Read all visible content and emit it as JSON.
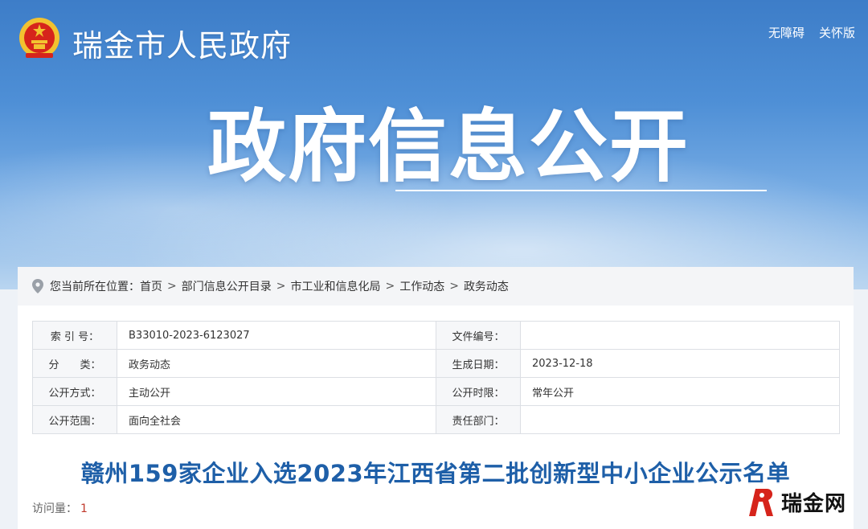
{
  "header": {
    "site_title": "瑞金市人民政府",
    "links": [
      "无障碍",
      "关怀版"
    ]
  },
  "hero": {
    "title": "政府信息公开"
  },
  "breadcrumb": {
    "prefix": "您当前所在位置：",
    "items": [
      "首页",
      "部门信息公开目录",
      "市工业和信息化局",
      "工作动态",
      "政务动态"
    ],
    "separator": ">"
  },
  "meta": {
    "rows": [
      {
        "l1": "索 引 号：",
        "v1": "B33010-2023-6123027",
        "l2": "文件编号：",
        "v2": ""
      },
      {
        "l1": "分　　类：",
        "v1": "政务动态",
        "l2": "生成日期：",
        "v2": "2023-12-18"
      },
      {
        "l1": "公开方式：",
        "v1": "主动公开",
        "l2": "公开时限：",
        "v2": "常年公开"
      },
      {
        "l1": "公开范围：",
        "v1": "面向全社会",
        "l2": "责任部门：",
        "v2": ""
      }
    ]
  },
  "article": {
    "title": "赣州159家企业入选2023年江西省第二批创新型中小企业公示名单",
    "visits_label": "访问量：",
    "visits_count": "1"
  },
  "watermark": {
    "text": "瑞金网"
  },
  "colors": {
    "title_blue": "#1e5fa8",
    "banner_blue": "#3d7dc8",
    "emblem_red": "#d6241b",
    "emblem_gold": "#f2c230"
  }
}
